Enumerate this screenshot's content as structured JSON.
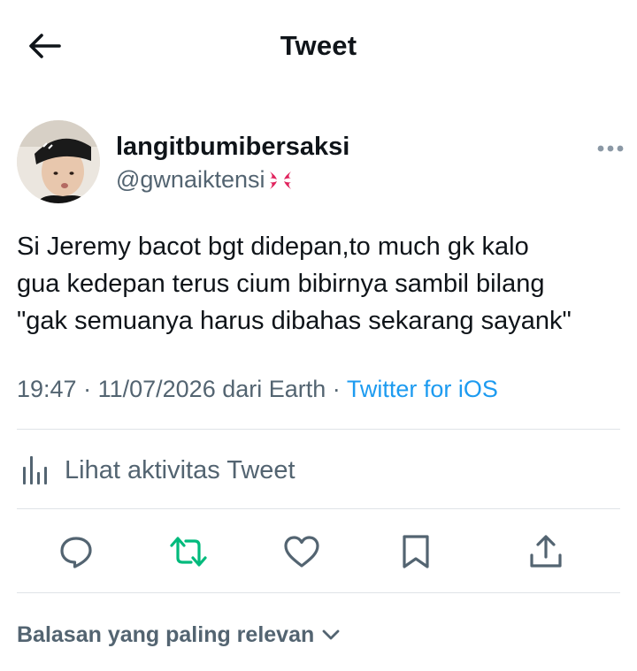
{
  "header": {
    "title": "Tweet",
    "back_icon": "arrow-left-icon"
  },
  "author": {
    "display_name": "langitbumibersaksi",
    "handle": "@gwnaiktensi",
    "handle_emoji": "anger-symbol-icon",
    "avatar": "profile-photo"
  },
  "tweet": {
    "lines": [
      "Si Jeremy bacot bgt didepan,to much gk kalo",
      "gua kedepan terus cium bibirnya sambil bilang",
      "\"gak semuanya harus dibahas sekarang sayank\""
    ]
  },
  "meta": {
    "time": "19:47",
    "date": "11/07/2026",
    "location": "dari Earth",
    "separator": " · ",
    "source": "Twitter for iOS"
  },
  "activity": {
    "label": "Lihat aktivitas Tweet",
    "icon": "analytics-bar-icon"
  },
  "actions": [
    {
      "name": "reply",
      "icon": "reply-bubble-icon"
    },
    {
      "name": "retweet",
      "icon": "retweet-icon"
    },
    {
      "name": "like",
      "icon": "heart-icon"
    },
    {
      "name": "bookmark",
      "icon": "bookmark-icon"
    },
    {
      "name": "share",
      "icon": "share-icon"
    }
  ],
  "replies": {
    "label": "Balasan yang paling relevan",
    "icon": "chevron-down-icon"
  },
  "colors": {
    "text": "#0f1419",
    "secondary": "#536471",
    "link": "#1d9bf0",
    "retweet": "#00ba7c",
    "divider": "#dfe3e7"
  }
}
